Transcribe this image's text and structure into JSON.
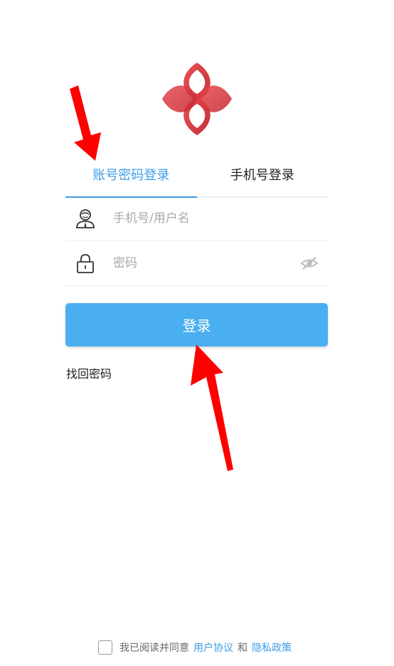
{
  "tabs": {
    "account_login": "账号密码登录",
    "phone_login": "手机号登录"
  },
  "form": {
    "username_placeholder": "手机号/用户名",
    "password_placeholder": "密码"
  },
  "login_button": "登录",
  "forgot_password": "找回密码",
  "agreement": {
    "prefix": "我已阅读并同意",
    "user_agreement": "用户协议",
    "and": "和",
    "privacy_policy": "隐私政策"
  },
  "colors": {
    "accent": "#3d9ce6",
    "button": "#4aaff0",
    "logo": "#d9343a",
    "annotation_arrow": "#ff0000"
  },
  "icons": {
    "user": "user-icon",
    "lock": "lock-icon",
    "eye": "eye-hidden-icon"
  }
}
